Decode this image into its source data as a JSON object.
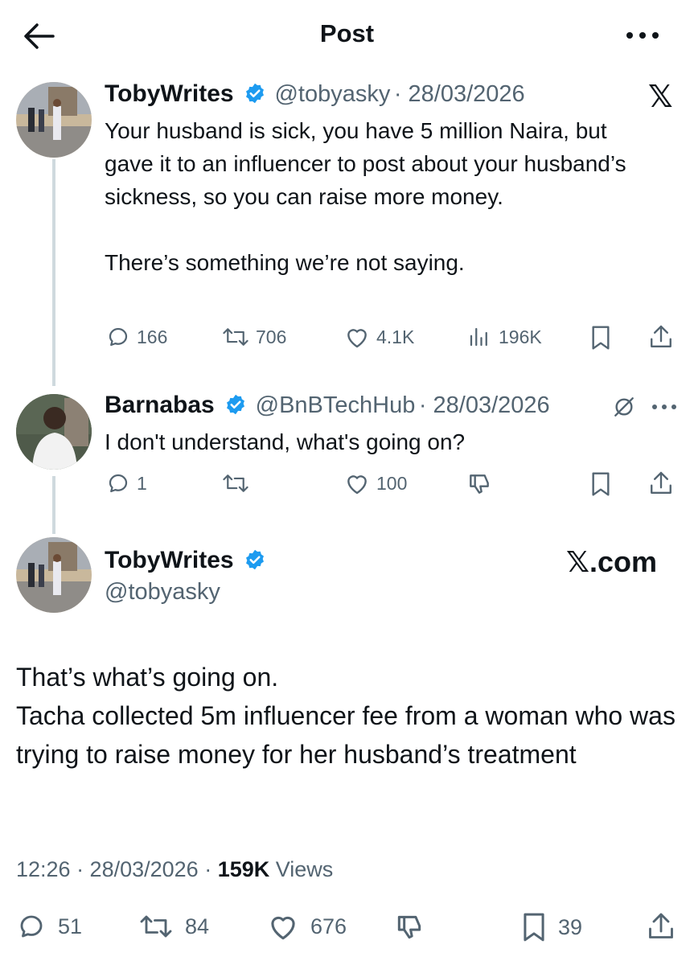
{
  "header": {
    "title": "Post",
    "back_icon": "arrow-left-icon",
    "more_icon": "more-horizontal-icon"
  },
  "tweet1": {
    "name": "TobyWrites",
    "handle": "@tobyasky",
    "date": "· 28/03/2026",
    "text": "Your husband is sick, you have 5 million Naira, but gave it to an influencer to post about your husband’s sickness, so you can raise more money.\n\nThere’s something we’re not saying.",
    "replies": "166",
    "reposts": "706",
    "likes": "4.1K",
    "views": "196K",
    "platform_logo": "𝕏"
  },
  "tweet2": {
    "name": "Barnabas",
    "handle": "@BnBTechHub",
    "date": "· 28/03/2026",
    "text": "I don't understand, what's going on?",
    "replies": "1",
    "reposts": "",
    "likes": "100"
  },
  "main": {
    "name": "TobyWrites",
    "handle": "@tobyasky",
    "site_label": "𝕏.com",
    "text_line1": "That’s what’s going on.",
    "text_line2": "Tacha collected 5m influencer fee from a woman who was trying to raise money for her husband’s treatment",
    "time": "12:26 · 28/03/2026 ·",
    "views_count": "159K",
    "views_label": "Views",
    "replies": "51",
    "reposts": "84",
    "likes": "676",
    "bookmarks": "39"
  },
  "colors": {
    "verified": "#1d9bf0",
    "muted": "#536471",
    "text": "#0f1419",
    "thread_line": "#cfd9de"
  }
}
